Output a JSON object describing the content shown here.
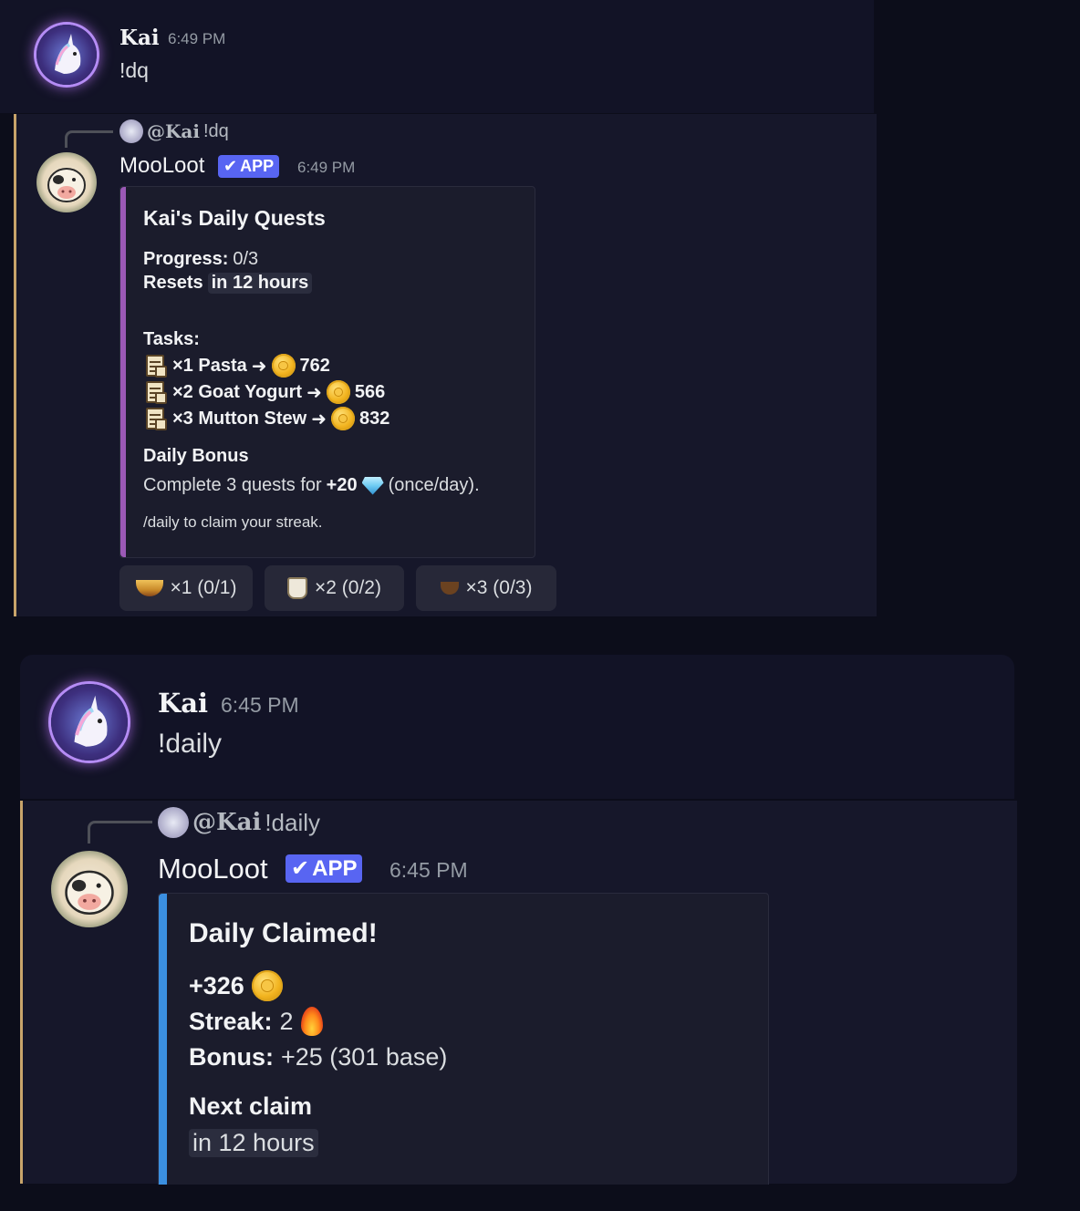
{
  "colors": {
    "background": "#0c0d1a",
    "message_bg": "#16172a",
    "reply_accent": "#c8a46a",
    "app_badge": "#5865f2",
    "quests_embed_bar": "#9b59b6",
    "daily_embed_bar": "#3b8fe0"
  },
  "messages": [
    {
      "author": "Kai",
      "time": "6:49 PM",
      "content": "!dq",
      "avatar_icon": "unicorn-avatar-icon"
    },
    {
      "reply": {
        "mention": "@Kai",
        "text": "!dq"
      },
      "author": "MooLoot",
      "badge": "APP",
      "time": "6:49 PM",
      "avatar_icon": "cow-avatar-icon",
      "embed": {
        "title": "Kai's Daily Quests",
        "progress_label": "Progress:",
        "progress_value": "0/3",
        "resets_label": "Resets",
        "resets_value": "in 12 hours",
        "tasks_label": "Tasks:",
        "tasks": [
          {
            "text": "×1 Pasta",
            "reward": "762",
            "icon": "scroll-icon"
          },
          {
            "text": "×2 Goat Yogurt",
            "reward": "566",
            "icon": "scroll-icon"
          },
          {
            "text": "×3 Mutton Stew",
            "reward": "832",
            "icon": "scroll-icon"
          }
        ],
        "arrow": "➜",
        "bonus_title": "Daily Bonus",
        "bonus_pre": "Complete 3 quests for",
        "bonus_amount": "+20",
        "bonus_post": "(once/day).",
        "footer": "/daily to claim your streak."
      },
      "buttons": [
        {
          "label": "×1 (0/1)",
          "icon": "pasta-icon"
        },
        {
          "label": "×2 (0/2)",
          "icon": "goat-yogurt-icon"
        },
        {
          "label": "×3 (0/3)",
          "icon": "mutton-stew-icon"
        }
      ]
    },
    {
      "author": "Kai",
      "time": "6:45 PM",
      "content": "!daily",
      "avatar_icon": "unicorn-avatar-icon"
    },
    {
      "reply": {
        "mention": "@Kai",
        "text": "!daily"
      },
      "author": "MooLoot",
      "badge": "APP",
      "time": "6:45 PM",
      "avatar_icon": "cow-avatar-icon",
      "embed": {
        "title": "Daily Claimed!",
        "amount": "+326",
        "streak_label": "Streak:",
        "streak_value": "2",
        "bonus_label": "Bonus:",
        "bonus_value": "+25 (301 base)",
        "next_claim_label": "Next claim",
        "next_claim_value": "in 12 hours"
      }
    }
  ]
}
